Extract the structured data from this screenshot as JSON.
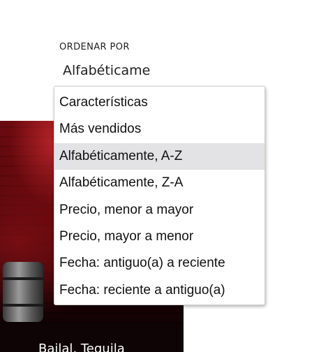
{
  "sort": {
    "label": "ORDENAR POR",
    "current_value": "Alfabéticame",
    "options": [
      "Características",
      "Más vendidos",
      "Alfabéticamente, A-Z",
      "Alfabéticamente, Z-A",
      "Precio, menor a mayor",
      "Precio, mayor a menor",
      "Fecha: antiguo(a) a reciente",
      "Fecha: reciente a antiguo(a)"
    ],
    "highlighted_option": "Alfabéticamente, A-Z"
  },
  "product": {
    "title": "Bailal, Tequila"
  },
  "colors": {
    "highlight": "#e3e3e6",
    "card_background": "#0e0405"
  }
}
